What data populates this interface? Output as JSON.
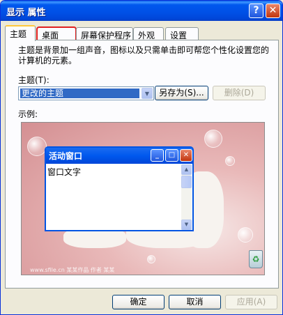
{
  "window": {
    "title": "显示 属性",
    "help_glyph": "?",
    "close_glyph": "✕"
  },
  "tabs": [
    {
      "label": "主题"
    },
    {
      "label": "桌面"
    },
    {
      "label": "屏幕保护程序"
    },
    {
      "label": "外观"
    },
    {
      "label": "设置"
    }
  ],
  "theme_page": {
    "description": "主题是背景加一组声音，图标以及只需单击即可帮您个性化设置您的计算机的元素。",
    "theme_label": "主题(T):",
    "theme_value": "更改的主题",
    "save_as_label": "另存为(S)...",
    "delete_label": "删除(D)",
    "example_label": "示例:"
  },
  "preview": {
    "active_window_title": "活动窗口",
    "window_text": "窗口文字",
    "watermark": "www.sfile.cn  某某作品 作者 某某"
  },
  "buttons": {
    "ok": "确定",
    "cancel": "取消",
    "apply": "应用(A)"
  },
  "colors": {
    "title_bar": "#0054e3",
    "selection": "#316ac5",
    "tab_highlight_box": "#e02020",
    "dialog_bg": "#ece9d8"
  }
}
